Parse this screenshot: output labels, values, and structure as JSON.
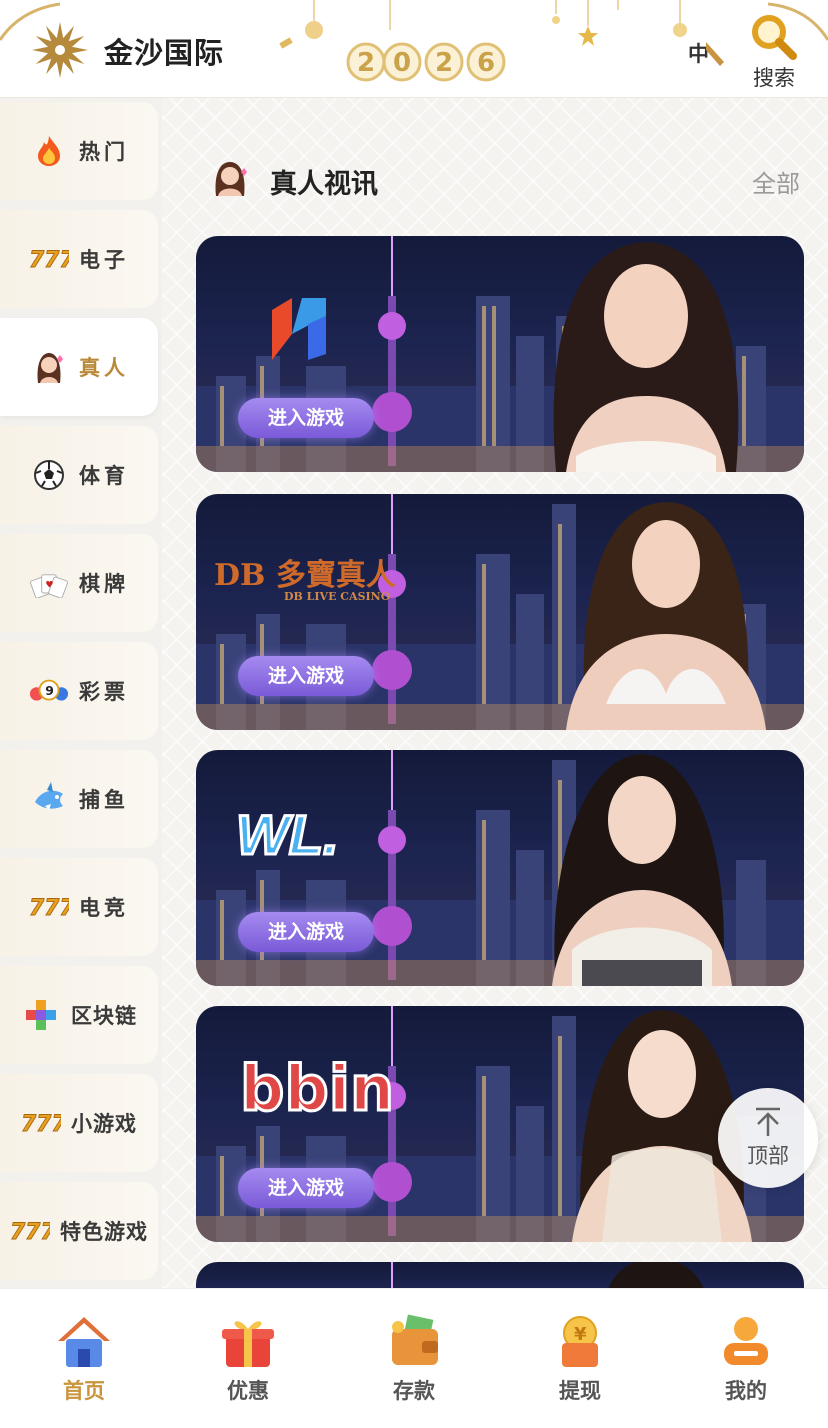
{
  "header": {
    "brand": "金沙国际",
    "year_decoration": "2026",
    "language": "中",
    "search_label": "搜索"
  },
  "sidebar": {
    "items": [
      {
        "label": "热门",
        "icon": "fire-icon"
      },
      {
        "label": "电子",
        "icon": "slot-777-icon"
      },
      {
        "label": "真人",
        "icon": "live-dealer-icon",
        "active": true
      },
      {
        "label": "体育",
        "icon": "soccer-ball-icon"
      },
      {
        "label": "棋牌",
        "icon": "playing-cards-icon"
      },
      {
        "label": "彩票",
        "icon": "lottery-balls-icon"
      },
      {
        "label": "捕鱼",
        "icon": "shark-icon"
      },
      {
        "label": "电竞",
        "icon": "slot-777-icon"
      },
      {
        "label": "区块链",
        "icon": "blocks-icon"
      },
      {
        "label": "小游戏",
        "icon": "slot-777-icon"
      },
      {
        "label": "特色游戏",
        "icon": "slot-777-icon"
      }
    ]
  },
  "section": {
    "title": "真人视讯",
    "all_label": "全部"
  },
  "cards": [
    {
      "logo": "R-logo",
      "logo_text": "",
      "logo_subtext": "",
      "button": "进入游戏"
    },
    {
      "logo": "DB-logo",
      "logo_text": "DB 多寶真人",
      "logo_subtext": "DB LIVE CASINO",
      "button": "进入游戏"
    },
    {
      "logo": "WL-logo",
      "logo_text": "WL.",
      "logo_subtext": "",
      "button": "进入游戏"
    },
    {
      "logo": "bbin-logo",
      "logo_text": "bbin",
      "logo_subtext": "",
      "button": "进入游戏"
    }
  ],
  "back_to_top": "顶部",
  "tabbar": {
    "items": [
      {
        "label": "首页",
        "icon": "home-icon",
        "active": true
      },
      {
        "label": "优惠",
        "icon": "gift-icon"
      },
      {
        "label": "存款",
        "icon": "wallet-icon"
      },
      {
        "label": "提现",
        "icon": "withdraw-icon"
      },
      {
        "label": "我的",
        "icon": "profile-icon"
      }
    ]
  },
  "colors": {
    "accent_gold": "#c8943c",
    "enter_button": "#8a6ae0",
    "card_bg": "#1c2450"
  }
}
